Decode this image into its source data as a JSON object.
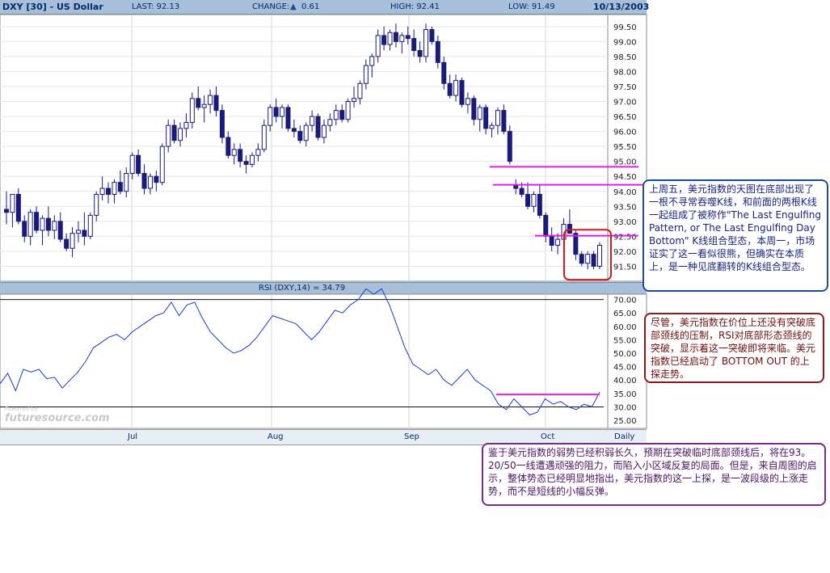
{
  "header": {
    "symbol": "DXY [30] - US Dollar",
    "last": "LAST: 92.13",
    "change_label": "CHANGE:",
    "change_value": "0.61",
    "high": "HIGH: 92.41",
    "low": "LOW: 91.49",
    "date": "10/13/2003"
  },
  "rsi_title": "RSI (DXY,14) = 34.79",
  "watermark": "futuresource.com",
  "watermark_small": "Powered by",
  "x_axis": {
    "labels": [
      "Jul",
      "Aug",
      "Sep",
      "Oct",
      "Daily"
    ]
  },
  "notes": {
    "note1": "上周五，美元指数的天图在底部出现了一根不寻常吞噬K线，和前面的两根K线一起组成了被称作\"The Last Engulfing Pattern, or The Last Engulfing Day Bottom\" K线组合型态，本周一，市场证实了这一看似很熊，但确实在本质上，是一种见底翻转的K线组合型态。",
    "note2": "尽管，美元指数在价位上还没有突破底部颈线的压制，RSI对底部形态颈线的突破，显示着这一突破即将来临。美元指数已经启动了 BOTTOM OUT 的上探走势。",
    "note3": "鉴于美元指数的弱势已经积弱长久，预期在突破临时底部颈线后，将在93。20/50一线遭遇顽强的阻力，而陷入小区域反复的局面。但是，来自周图的启示，整体势态已经明显地指出，美元指数的这一上探，是一波段级的上涨走势，而不是短线的小幅反弹。"
  },
  "colors": {
    "up_candle": "#ffffff",
    "down_candle": "#1a1a7a",
    "candle_outline": "#1a1a7a",
    "rsi_line": "#1a3ccf",
    "annotation_magenta": "#e020e0",
    "annotation_red_box": "#d81818"
  },
  "chart_data": [
    {
      "type": "candlestick",
      "title": "DXY [30] - US Dollar",
      "ylim": [
        91.0,
        99.9
      ],
      "y_ticks": [
        "91.50",
        "92.00",
        "92.50",
        "93.00",
        "93.50",
        "94.00",
        "94.50",
        "95.00",
        "95.50",
        "96.00",
        "96.50",
        "97.00",
        "97.50",
        "98.00",
        "98.50",
        "99.00",
        "99.50"
      ],
      "x_ticks": [
        "Jul",
        "Aug",
        "Sep",
        "Oct"
      ],
      "grid": true,
      "ohlc": [
        [
          93.4,
          94.0,
          92.9,
          93.3
        ],
        [
          93.3,
          93.9,
          92.8,
          93.9
        ],
        [
          93.9,
          94.1,
          92.9,
          93.0
        ],
        [
          93.0,
          93.2,
          92.3,
          92.5
        ],
        [
          92.5,
          93.4,
          92.2,
          93.3
        ],
        [
          93.3,
          93.5,
          92.6,
          92.7
        ],
        [
          92.7,
          93.2,
          92.2,
          93.1
        ],
        [
          93.1,
          93.5,
          92.5,
          92.7
        ],
        [
          92.7,
          93.2,
          92.4,
          93.0
        ],
        [
          93.0,
          93.3,
          92.3,
          92.4
        ],
        [
          92.4,
          92.6,
          92.0,
          92.1
        ],
        [
          92.1,
          92.8,
          91.8,
          92.6
        ],
        [
          92.6,
          93.0,
          92.3,
          92.7
        ],
        [
          92.7,
          93.3,
          92.2,
          92.5
        ],
        [
          92.5,
          93.3,
          92.4,
          93.2
        ],
        [
          93.2,
          94.0,
          93.0,
          93.9
        ],
        [
          93.9,
          94.5,
          93.7,
          94.1
        ],
        [
          94.1,
          94.3,
          93.6,
          93.9
        ],
        [
          93.9,
          94.4,
          93.6,
          94.3
        ],
        [
          94.3,
          94.7,
          93.9,
          94.0
        ],
        [
          94.0,
          94.8,
          93.8,
          94.6
        ],
        [
          94.6,
          95.3,
          94.4,
          95.2
        ],
        [
          95.2,
          95.4,
          94.5,
          94.6
        ],
        [
          94.6,
          94.9,
          93.9,
          94.1
        ],
        [
          94.1,
          94.6,
          93.9,
          94.5
        ],
        [
          94.5,
          94.7,
          94.0,
          94.3
        ],
        [
          94.3,
          95.6,
          94.2,
          95.5
        ],
        [
          95.5,
          96.4,
          95.3,
          96.2
        ],
        [
          96.2,
          96.4,
          95.6,
          95.7
        ],
        [
          95.7,
          96.3,
          95.5,
          96.1
        ],
        [
          96.1,
          96.6,
          95.8,
          96.3
        ],
        [
          96.3,
          97.3,
          96.1,
          97.1
        ],
        [
          97.1,
          97.5,
          96.7,
          96.8
        ],
        [
          96.8,
          97.2,
          96.3,
          96.9
        ],
        [
          96.9,
          97.4,
          96.6,
          97.2
        ],
        [
          97.2,
          97.5,
          96.5,
          96.7
        ],
        [
          96.7,
          96.9,
          95.6,
          95.8
        ],
        [
          95.8,
          96.0,
          95.1,
          95.2
        ],
        [
          95.2,
          95.6,
          94.9,
          95.4
        ],
        [
          95.4,
          95.6,
          94.8,
          95.0
        ],
        [
          95.0,
          95.2,
          94.6,
          94.9
        ],
        [
          94.9,
          95.3,
          94.8,
          95.2
        ],
        [
          95.2,
          95.6,
          95.0,
          95.4
        ],
        [
          95.4,
          96.4,
          95.3,
          96.2
        ],
        [
          96.2,
          96.9,
          96.0,
          96.8
        ],
        [
          96.8,
          97.1,
          96.3,
          96.5
        ],
        [
          96.5,
          96.9,
          96.1,
          96.8
        ],
        [
          96.8,
          96.9,
          96.0,
          96.1
        ],
        [
          96.1,
          96.4,
          95.8,
          96.0
        ],
        [
          96.0,
          96.2,
          95.6,
          95.7
        ],
        [
          95.7,
          96.3,
          95.5,
          96.2
        ],
        [
          96.2,
          96.7,
          96.0,
          96.5
        ],
        [
          96.5,
          96.6,
          95.7,
          95.8
        ],
        [
          95.8,
          96.4,
          95.6,
          96.2
        ],
        [
          96.2,
          96.6,
          96.0,
          96.4
        ],
        [
          96.4,
          96.9,
          96.2,
          96.7
        ],
        [
          96.7,
          96.9,
          96.3,
          96.4
        ],
        [
          96.4,
          97.1,
          96.3,
          97.0
        ],
        [
          97.0,
          97.5,
          96.8,
          97.1
        ],
        [
          97.1,
          97.7,
          96.9,
          97.6
        ],
        [
          97.6,
          98.4,
          97.4,
          98.2
        ],
        [
          98.2,
          98.6,
          97.8,
          98.5
        ],
        [
          98.5,
          99.4,
          98.3,
          99.2
        ],
        [
          99.2,
          99.5,
          98.7,
          98.9
        ],
        [
          98.9,
          99.4,
          98.7,
          99.3
        ],
        [
          99.3,
          99.6,
          98.8,
          99.0
        ],
        [
          99.0,
          99.3,
          98.6,
          99.2
        ],
        [
          99.2,
          99.5,
          98.9,
          99.1
        ],
        [
          99.1,
          99.4,
          98.5,
          98.7
        ],
        [
          98.7,
          99.0,
          98.3,
          98.5
        ],
        [
          98.5,
          99.6,
          98.3,
          99.4
        ],
        [
          99.4,
          99.5,
          98.9,
          99.0
        ],
        [
          99.0,
          99.2,
          98.1,
          98.3
        ],
        [
          98.3,
          98.5,
          97.4,
          97.6
        ],
        [
          97.6,
          97.9,
          97.1,
          97.2
        ],
        [
          97.2,
          97.9,
          97.0,
          97.7
        ],
        [
          97.7,
          97.8,
          96.8,
          96.9
        ],
        [
          96.9,
          97.3,
          96.6,
          97.1
        ],
        [
          97.1,
          97.2,
          96.2,
          96.4
        ],
        [
          96.4,
          96.9,
          96.0,
          96.8
        ],
        [
          96.8,
          96.9,
          95.9,
          96.1
        ],
        [
          96.1,
          96.3,
          95.8,
          96.2
        ],
        [
          96.2,
          96.8,
          95.9,
          96.7
        ],
        [
          96.7,
          96.9,
          95.9,
          96.0
        ],
        [
          96.0,
          96.2,
          94.9,
          95.0
        ],
        [
          94.2,
          94.4,
          93.9,
          94.1
        ],
        [
          94.1,
          94.3,
          93.8,
          93.9
        ],
        [
          93.9,
          94.3,
          93.4,
          93.5
        ],
        [
          93.5,
          94.0,
          93.3,
          93.9
        ],
        [
          93.9,
          94.2,
          93.1,
          93.2
        ],
        [
          93.2,
          93.3,
          92.3,
          92.5
        ],
        [
          92.5,
          92.8,
          92.0,
          92.2
        ],
        [
          92.2,
          92.6,
          91.9,
          92.4
        ],
        [
          92.4,
          93.1,
          92.1,
          92.9
        ],
        [
          92.9,
          93.4,
          92.6,
          92.6
        ],
        [
          92.6,
          92.7,
          91.7,
          91.9
        ],
        [
          91.9,
          92.0,
          91.5,
          91.6
        ],
        [
          91.6,
          92.0,
          91.4,
          91.9
        ],
        [
          91.9,
          92.0,
          91.4,
          91.5
        ],
        [
          91.5,
          92.3,
          91.4,
          92.2
        ]
      ],
      "annotations": [
        "95.00 neckline",
        "94.20 level",
        "92.50 neckline",
        "bottom engulfing box"
      ]
    },
    {
      "type": "line",
      "title": "RSI (DXY,14) = 34.79",
      "ylim": [
        22,
        72
      ],
      "y_ticks": [
        "25.00",
        "30.00",
        "35.00",
        "40.00",
        "45.00",
        "50.00",
        "55.00",
        "60.00",
        "65.00",
        "70.00"
      ],
      "reference_lines": [
        30,
        70
      ],
      "values": [
        38.6,
        42.5,
        36,
        44,
        43,
        44,
        40.5,
        41,
        37,
        40,
        43,
        47,
        52,
        54,
        56,
        57,
        55,
        58,
        60,
        62,
        64,
        65,
        69,
        64,
        68,
        69,
        63,
        58,
        55,
        52,
        50,
        51,
        53,
        56,
        60,
        64,
        63,
        62,
        61,
        58,
        55,
        58,
        62,
        66,
        65,
        68,
        70,
        74,
        72,
        74,
        68,
        60,
        52,
        46,
        44,
        42,
        44,
        40,
        38,
        41,
        44,
        40,
        38,
        36,
        31,
        29,
        33,
        30,
        27,
        28,
        33,
        31,
        32,
        30,
        29,
        31,
        30,
        35.5
      ]
    }
  ]
}
